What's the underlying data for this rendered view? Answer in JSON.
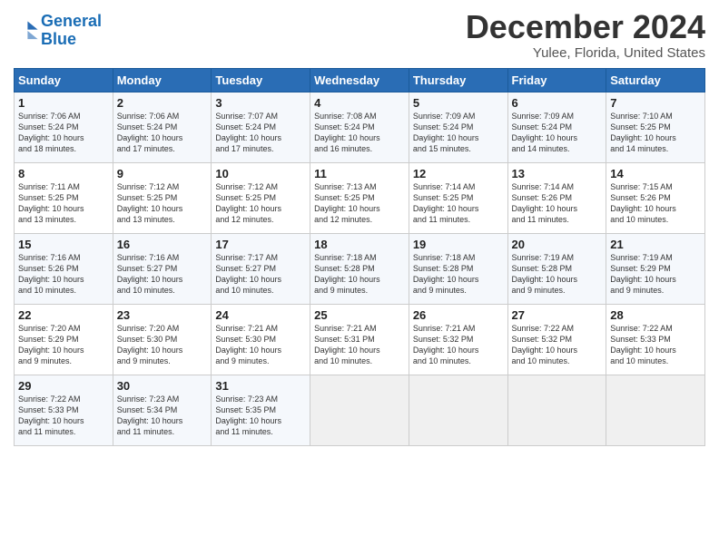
{
  "logo": {
    "line1": "General",
    "line2": "Blue"
  },
  "header": {
    "month": "December 2024",
    "location": "Yulee, Florida, United States"
  },
  "days_of_week": [
    "Sunday",
    "Monday",
    "Tuesday",
    "Wednesday",
    "Thursday",
    "Friday",
    "Saturday"
  ],
  "weeks": [
    [
      {
        "day": "1",
        "text": "Sunrise: 7:06 AM\nSunset: 5:24 PM\nDaylight: 10 hours\nand 18 minutes."
      },
      {
        "day": "2",
        "text": "Sunrise: 7:06 AM\nSunset: 5:24 PM\nDaylight: 10 hours\nand 17 minutes."
      },
      {
        "day": "3",
        "text": "Sunrise: 7:07 AM\nSunset: 5:24 PM\nDaylight: 10 hours\nand 17 minutes."
      },
      {
        "day": "4",
        "text": "Sunrise: 7:08 AM\nSunset: 5:24 PM\nDaylight: 10 hours\nand 16 minutes."
      },
      {
        "day": "5",
        "text": "Sunrise: 7:09 AM\nSunset: 5:24 PM\nDaylight: 10 hours\nand 15 minutes."
      },
      {
        "day": "6",
        "text": "Sunrise: 7:09 AM\nSunset: 5:24 PM\nDaylight: 10 hours\nand 14 minutes."
      },
      {
        "day": "7",
        "text": "Sunrise: 7:10 AM\nSunset: 5:25 PM\nDaylight: 10 hours\nand 14 minutes."
      }
    ],
    [
      {
        "day": "8",
        "text": "Sunrise: 7:11 AM\nSunset: 5:25 PM\nDaylight: 10 hours\nand 13 minutes."
      },
      {
        "day": "9",
        "text": "Sunrise: 7:12 AM\nSunset: 5:25 PM\nDaylight: 10 hours\nand 13 minutes."
      },
      {
        "day": "10",
        "text": "Sunrise: 7:12 AM\nSunset: 5:25 PM\nDaylight: 10 hours\nand 12 minutes."
      },
      {
        "day": "11",
        "text": "Sunrise: 7:13 AM\nSunset: 5:25 PM\nDaylight: 10 hours\nand 12 minutes."
      },
      {
        "day": "12",
        "text": "Sunrise: 7:14 AM\nSunset: 5:25 PM\nDaylight: 10 hours\nand 11 minutes."
      },
      {
        "day": "13",
        "text": "Sunrise: 7:14 AM\nSunset: 5:26 PM\nDaylight: 10 hours\nand 11 minutes."
      },
      {
        "day": "14",
        "text": "Sunrise: 7:15 AM\nSunset: 5:26 PM\nDaylight: 10 hours\nand 10 minutes."
      }
    ],
    [
      {
        "day": "15",
        "text": "Sunrise: 7:16 AM\nSunset: 5:26 PM\nDaylight: 10 hours\nand 10 minutes."
      },
      {
        "day": "16",
        "text": "Sunrise: 7:16 AM\nSunset: 5:27 PM\nDaylight: 10 hours\nand 10 minutes."
      },
      {
        "day": "17",
        "text": "Sunrise: 7:17 AM\nSunset: 5:27 PM\nDaylight: 10 hours\nand 10 minutes."
      },
      {
        "day": "18",
        "text": "Sunrise: 7:18 AM\nSunset: 5:28 PM\nDaylight: 10 hours\nand 9 minutes."
      },
      {
        "day": "19",
        "text": "Sunrise: 7:18 AM\nSunset: 5:28 PM\nDaylight: 10 hours\nand 9 minutes."
      },
      {
        "day": "20",
        "text": "Sunrise: 7:19 AM\nSunset: 5:28 PM\nDaylight: 10 hours\nand 9 minutes."
      },
      {
        "day": "21",
        "text": "Sunrise: 7:19 AM\nSunset: 5:29 PM\nDaylight: 10 hours\nand 9 minutes."
      }
    ],
    [
      {
        "day": "22",
        "text": "Sunrise: 7:20 AM\nSunset: 5:29 PM\nDaylight: 10 hours\nand 9 minutes."
      },
      {
        "day": "23",
        "text": "Sunrise: 7:20 AM\nSunset: 5:30 PM\nDaylight: 10 hours\nand 9 minutes."
      },
      {
        "day": "24",
        "text": "Sunrise: 7:21 AM\nSunset: 5:30 PM\nDaylight: 10 hours\nand 9 minutes."
      },
      {
        "day": "25",
        "text": "Sunrise: 7:21 AM\nSunset: 5:31 PM\nDaylight: 10 hours\nand 10 minutes."
      },
      {
        "day": "26",
        "text": "Sunrise: 7:21 AM\nSunset: 5:32 PM\nDaylight: 10 hours\nand 10 minutes."
      },
      {
        "day": "27",
        "text": "Sunrise: 7:22 AM\nSunset: 5:32 PM\nDaylight: 10 hours\nand 10 minutes."
      },
      {
        "day": "28",
        "text": "Sunrise: 7:22 AM\nSunset: 5:33 PM\nDaylight: 10 hours\nand 10 minutes."
      }
    ],
    [
      {
        "day": "29",
        "text": "Sunrise: 7:22 AM\nSunset: 5:33 PM\nDaylight: 10 hours\nand 11 minutes."
      },
      {
        "day": "30",
        "text": "Sunrise: 7:23 AM\nSunset: 5:34 PM\nDaylight: 10 hours\nand 11 minutes."
      },
      {
        "day": "31",
        "text": "Sunrise: 7:23 AM\nSunset: 5:35 PM\nDaylight: 10 hours\nand 11 minutes."
      },
      {
        "day": "",
        "text": ""
      },
      {
        "day": "",
        "text": ""
      },
      {
        "day": "",
        "text": ""
      },
      {
        "day": "",
        "text": ""
      }
    ]
  ]
}
